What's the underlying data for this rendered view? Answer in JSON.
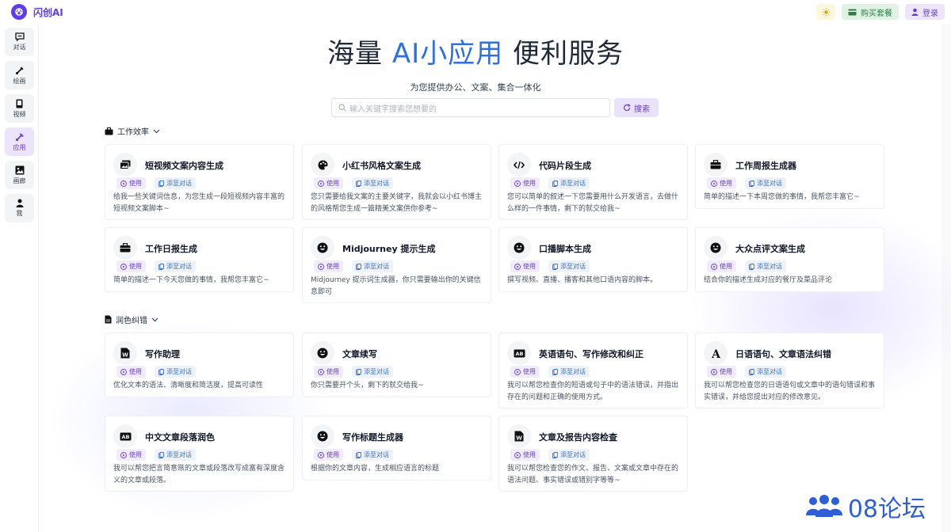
{
  "app": {
    "name": "闪创AI",
    "buy_label": "购买套餐",
    "login_label": "登录"
  },
  "sidebar": {
    "items": [
      {
        "label": "对话",
        "icon": "chat-icon"
      },
      {
        "label": "绘画",
        "icon": "brush-icon"
      },
      {
        "label": "视频",
        "icon": "video-icon"
      },
      {
        "label": "应用",
        "icon": "apps-icon",
        "active": true
      },
      {
        "label": "画廊",
        "icon": "gallery-icon"
      },
      {
        "label": "我",
        "icon": "user-icon"
      }
    ]
  },
  "hero": {
    "title_pre": "海量",
    "title_accent": "AI小应用",
    "title_post": "便利服务",
    "subtitle": "为您提供办公、文案、集合一体化"
  },
  "search": {
    "placeholder": "输入关键字搜索您想要的",
    "button_label": "搜索"
  },
  "chip_labels": {
    "use": "使用",
    "add": "添至对话"
  },
  "sections": [
    {
      "title": "工作效率",
      "cards": [
        {
          "title": "短视频文案内容生成",
          "icon": "image-stack-icon",
          "desc": "给我一些关键词信息，为您生成一段短视频内容丰富的短视频文案脚本~"
        },
        {
          "title": "小红书风格文案生成",
          "icon": "palette-icon",
          "desc": "您只需要给我文案的主要关键字，我就会以小红书博主的风格帮您生成一篇精美文案供你参考~"
        },
        {
          "title": "代码片段生成",
          "icon": "code-icon",
          "desc": "您可以简单的叙述一下您需要用什么开发语言，去做什么样的一件事情，剩下的就交给我~"
        },
        {
          "title": "工作周报生成器",
          "icon": "briefcase-icon",
          "desc": "简单的描述一下本周您做的事情，我帮您丰富它~"
        },
        {
          "title": "工作日报生成",
          "icon": "briefcase-icon",
          "desc": "简单的描述一下今天您做的事情，我帮您丰富它~"
        },
        {
          "title": "Midjourney 提示生成",
          "icon": "smile-icon",
          "desc": "Midjourney 提示词生成器，你只需要输出你的关键信息即可"
        },
        {
          "title": "口播脚本生成",
          "icon": "smile-icon",
          "desc": "撰写视频、直播、播客和其他口语内容的脚本。"
        },
        {
          "title": "大众点评文案生成",
          "icon": "smile-icon",
          "desc": "结合你的描述生成对应的餐厅及菜品评论"
        }
      ]
    },
    {
      "title": "润色纠错",
      "cards": [
        {
          "title": "写作助理",
          "icon": "word-doc-icon",
          "desc": "优化文本的语法、清晰度和简洁度，提高可读性"
        },
        {
          "title": "文章续写",
          "icon": "smile-icon",
          "desc": "你只需要开个头，剩下的就交给我~"
        },
        {
          "title": "英语语句、写作修改和纠正",
          "icon": "ab-text-icon",
          "desc": "我可以帮您检查你的短语或句子中的语法错误，并指出存在的问题和正确的使用方式。"
        },
        {
          "title": "日语语句、文章语法纠错",
          "icon": "font-a-icon",
          "desc": "我可以帮您检查您的日语语句或文章中的语句错误和事实错误，并给您提出对应的修改意见。"
        },
        {
          "title": "中文文章段落润色",
          "icon": "ab-text-icon",
          "desc": "我可以帮您把言简意赅的文章或段落改写成富有深度含义的文章或段落。"
        },
        {
          "title": "写作标题生成器",
          "icon": "smile-icon",
          "desc": "根据你的文章内容，生成相应语言的标题"
        },
        {
          "title": "文章及报告内容检查",
          "icon": "word-doc-icon",
          "desc": "我可以帮您检查您的作文、报告、文案或文章中存在的语法问题、事实错误或错别字等等~"
        }
      ]
    }
  ],
  "watermark": {
    "text": "08论坛"
  }
}
